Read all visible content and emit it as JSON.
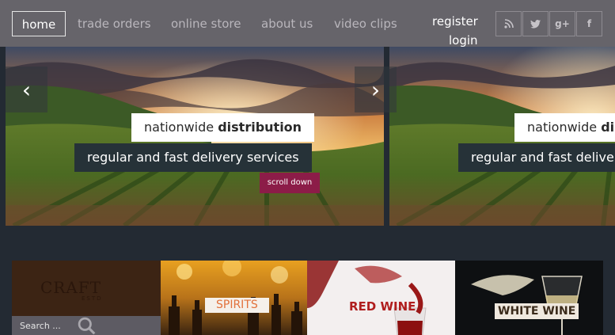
{
  "nav": {
    "items": [
      "home",
      "trade orders",
      "online store",
      "about us",
      "video clips"
    ],
    "register": "register",
    "login": "login"
  },
  "social": {
    "icons": [
      "rss-icon",
      "twitter-icon",
      "google-plus-icon",
      "facebook-icon"
    ],
    "glyphs": [
      "ʃ",
      "t",
      "g+",
      "f"
    ]
  },
  "slides": [
    {
      "title_prefix": "nationwide ",
      "title_bold": "distribution",
      "subtitle": "regular and fast delivery services"
    },
    {
      "title_prefix": "nationwide ",
      "title_bold": "distribution",
      "subtitle": "regular and fast delivery services"
    }
  ],
  "scroll_button": "scroll down",
  "arrows": {
    "left": "‹",
    "right": "›"
  },
  "logo": {
    "name": "CRAFT",
    "sub": "ESTD"
  },
  "search": {
    "placeholder": "Search ..."
  },
  "tiles": {
    "spirits": "SPIRITS",
    "red_wine": "RED WINE",
    "white_wine": "WHITE WINE"
  },
  "colors": {
    "topbar": "#66646a",
    "accent": "#8c1c48",
    "background": "#232a33",
    "caption_dark": "#263238"
  }
}
